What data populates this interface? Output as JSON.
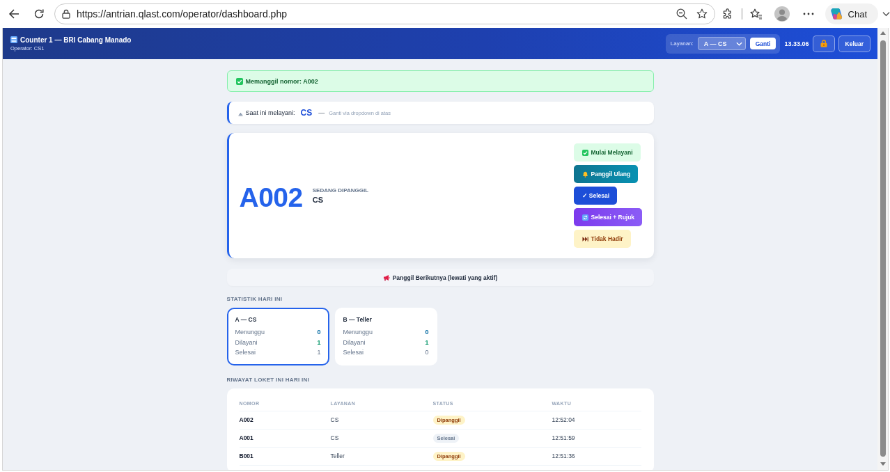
{
  "browser": {
    "url": "https://antrian.qlast.com/operator/dashboard.php",
    "chat_label": "Chat"
  },
  "header": {
    "title": "Counter 1 — BRI Cabang Manado",
    "operator": "Operator: CS1",
    "service_label": "Layanan:",
    "service_select": {
      "value": "A — CS"
    },
    "switch_button": "Ganti",
    "clock": "13.33.06",
    "logout_button": "Keluar"
  },
  "alert": {
    "text": "Memanggil nomor: A002"
  },
  "serving": {
    "label": "Saat ini melayani:",
    "service": "CS",
    "separator": "—",
    "hint": "Ganti via dropdown di atas"
  },
  "current_ticket": {
    "number": "A002",
    "status_label": "SEDANG DIPANGGIL",
    "service": "CS",
    "actions": [
      {
        "kind": "start",
        "label": "Mulai Melayani"
      },
      {
        "kind": "recall",
        "label": "Panggil Ulang"
      },
      {
        "kind": "finish",
        "label": "✓ Selesai"
      },
      {
        "kind": "refer",
        "label": "Selesai + Rujuk"
      },
      {
        "kind": "absent",
        "label": "Tidak Hadir"
      }
    ]
  },
  "next_button": {
    "label": "Panggil Berikutnya (lewati yang aktif)"
  },
  "stats": {
    "title": "STATISTIK HARI INI",
    "cards": [
      {
        "title": "A — CS",
        "selected": true,
        "rows": [
          {
            "kind": "waiting",
            "label": "Menunggu",
            "value": "0"
          },
          {
            "kind": "served",
            "label": "Dilayani",
            "value": "1"
          },
          {
            "kind": "done",
            "label": "Selesai",
            "value": "1"
          }
        ]
      },
      {
        "title": "B — Teller",
        "selected": false,
        "rows": [
          {
            "kind": "waiting",
            "label": "Menunggu",
            "value": "0"
          },
          {
            "kind": "served",
            "label": "Dilayani",
            "value": "1"
          },
          {
            "kind": "done",
            "label": "Selesai",
            "value": "0"
          }
        ]
      }
    ]
  },
  "history": {
    "title": "RIWAYAT LOKET INI HARI INI",
    "columns": [
      "NOMOR",
      "LAYANAN",
      "STATUS",
      "WAKTU"
    ],
    "rows": [
      {
        "number": "A002",
        "service": "CS",
        "status": {
          "kind": "called",
          "label": "Dipanggil"
        },
        "time": "12:52:04"
      },
      {
        "number": "A001",
        "service": "CS",
        "status": {
          "kind": "done",
          "label": "Selesai"
        },
        "time": "12:51:59"
      },
      {
        "number": "B001",
        "service": "Teller",
        "status": {
          "kind": "called",
          "label": "Dipanggil"
        },
        "time": "12:51:36"
      }
    ]
  }
}
